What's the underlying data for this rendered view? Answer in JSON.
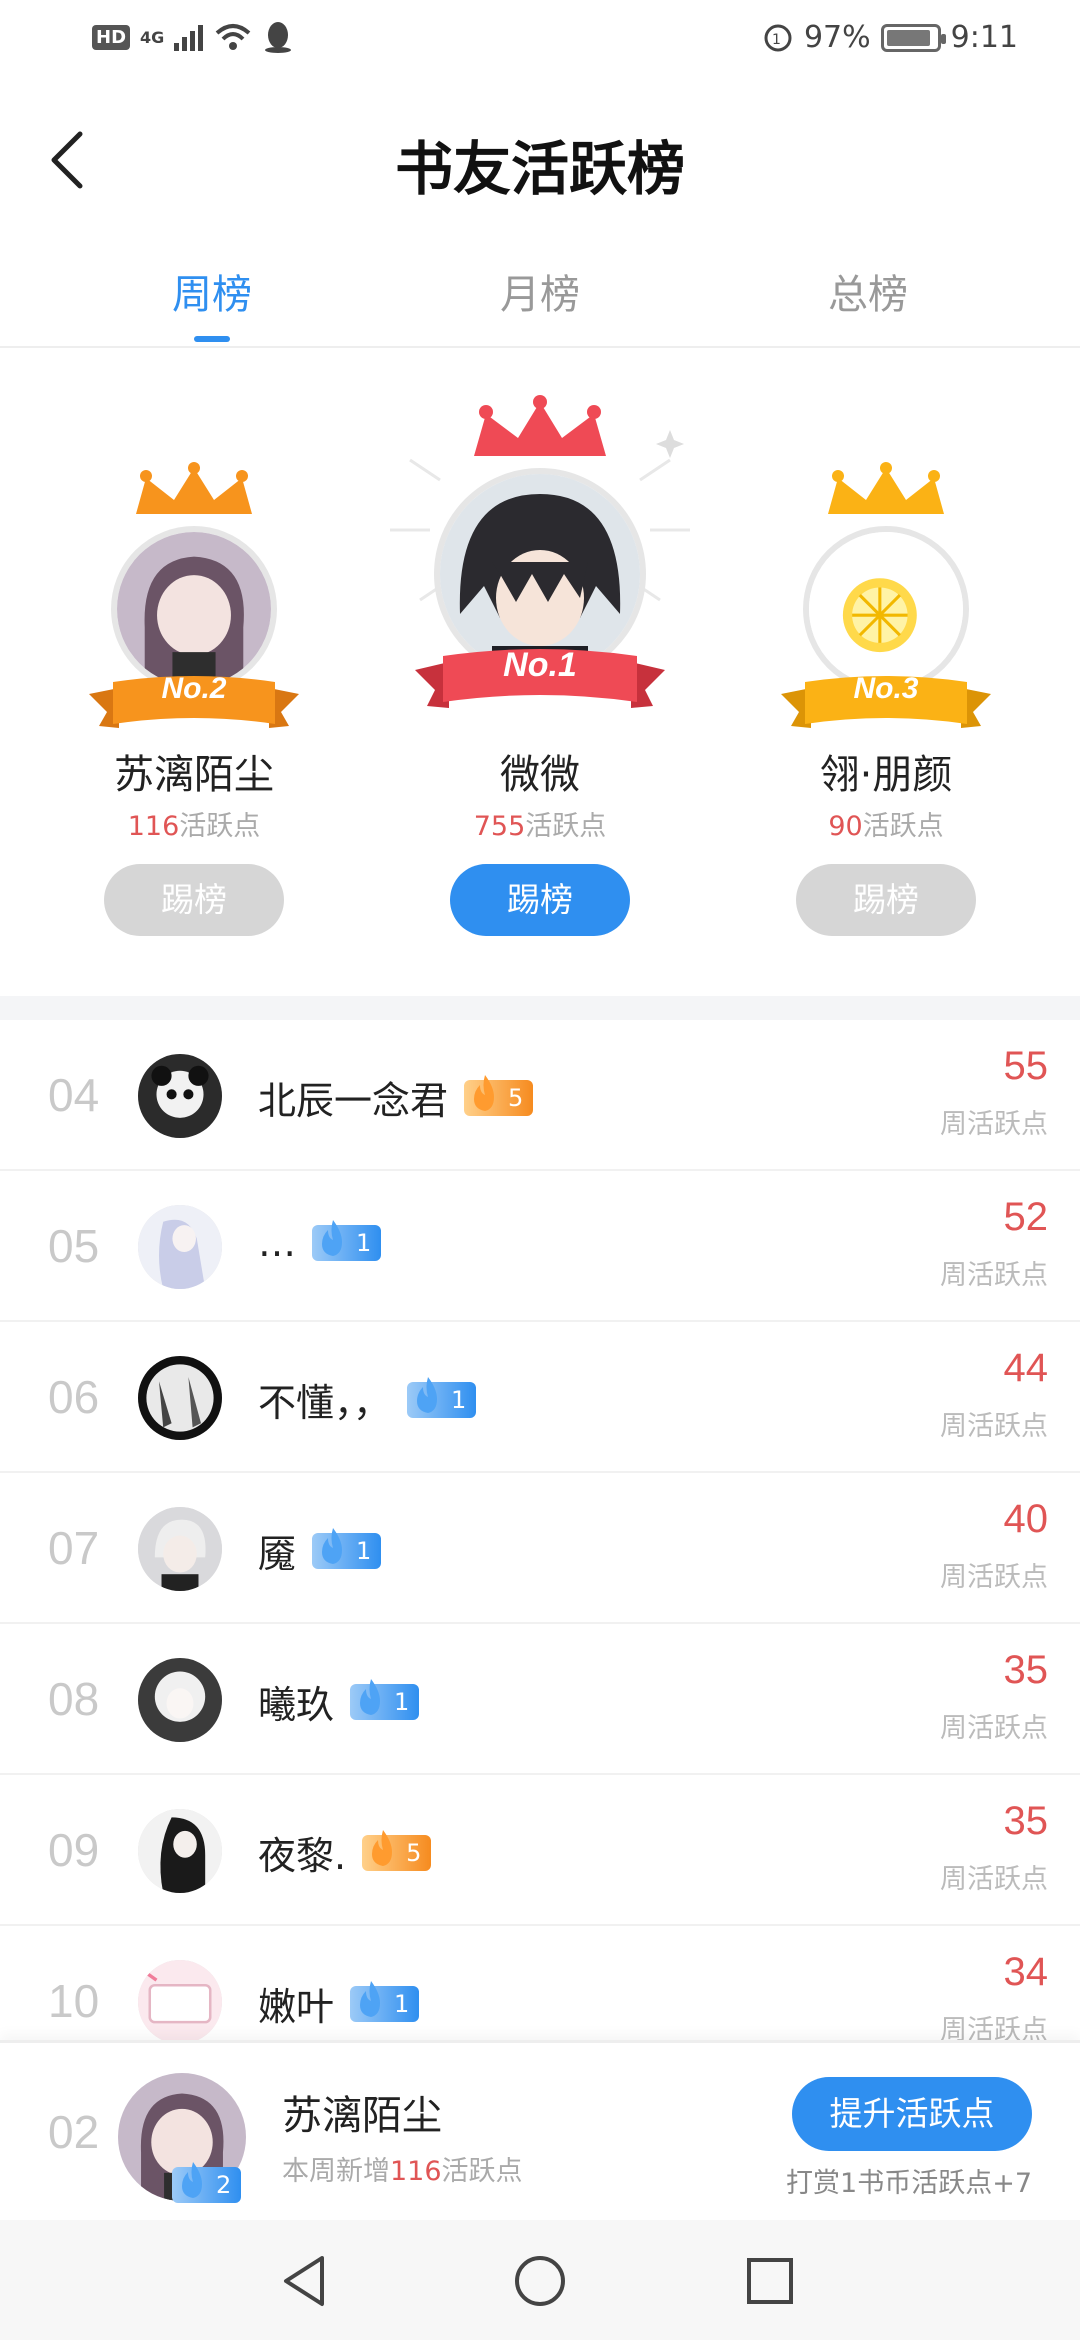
{
  "status_bar": {
    "hd": "HD",
    "network": "4G",
    "battery_pct": "97%",
    "time": "9:11"
  },
  "header": {
    "title": "书友活跃榜"
  },
  "tabs": [
    {
      "label": "周榜",
      "active": true
    },
    {
      "label": "月榜",
      "active": false
    },
    {
      "label": "总榜",
      "active": false
    }
  ],
  "podium": {
    "second": {
      "badge": "No.2",
      "name": "苏漓陌尘",
      "points": "116",
      "points_suffix": "活跃点",
      "button": "踢榜"
    },
    "first": {
      "badge": "No.1",
      "name": "微微",
      "points": "755",
      "points_suffix": "活跃点",
      "button": "踢榜"
    },
    "third": {
      "badge": "No.3",
      "name": "翎·朋颜",
      "points": "90",
      "points_suffix": "活跃点",
      "button": "踢榜"
    }
  },
  "list": [
    {
      "rank": "04",
      "name": "北辰一念君",
      "level": "5",
      "level_color": "orange",
      "score": "55",
      "score_label": "周活跃点"
    },
    {
      "rank": "05",
      "name": "…",
      "level": "1",
      "level_color": "blue",
      "score": "52",
      "score_label": "周活跃点"
    },
    {
      "rank": "06",
      "name": "不懂，，",
      "level": "1",
      "level_color": "blue",
      "score": "44",
      "score_label": "周活跃点"
    },
    {
      "rank": "07",
      "name": "魇",
      "level": "1",
      "level_color": "blue",
      "score": "40",
      "score_label": "周活跃点"
    },
    {
      "rank": "08",
      "name": "曦玖",
      "level": "1",
      "level_color": "blue",
      "score": "35",
      "score_label": "周活跃点"
    },
    {
      "rank": "09",
      "name": "夜黎.",
      "level": "5",
      "level_color": "orange",
      "score": "35",
      "score_label": "周活跃点"
    },
    {
      "rank": "10",
      "name": "嫩叶",
      "level": "1",
      "level_color": "blue",
      "score": "34",
      "score_label": "周活跃点"
    }
  ],
  "my_rank": {
    "rank": "02",
    "name": "苏漓陌尘",
    "level": "2",
    "desc_prefix": "本周新增",
    "desc_points": "116",
    "desc_suffix": "活跃点",
    "button": "提升活跃点",
    "tip": "打赏1书币活跃点+7"
  },
  "colors": {
    "accent": "#2f8ff0",
    "score_red": "#e05555",
    "crown_first": "#ef4a55",
    "crown_second": "#f7941d",
    "crown_third": "#fbb215"
  },
  "icons": {
    "back": "chevron-left-icon",
    "nav_back": "triangle-back-icon",
    "nav_home": "circle-home-icon",
    "nav_recent": "square-recent-icon"
  }
}
